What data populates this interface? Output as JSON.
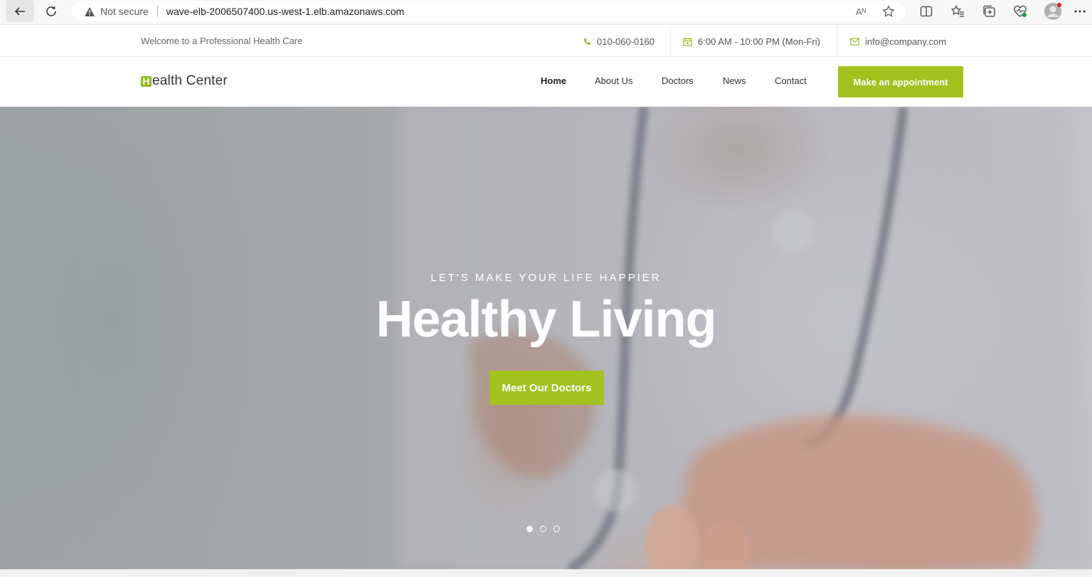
{
  "browser": {
    "security_label": "Not secure",
    "url": "wave-elb-2006507400.us-west-1.elb.amazonaws.com",
    "read_aloud_label": "Aᴺ"
  },
  "topbar": {
    "welcome": "Welcome to a Professional Health Care",
    "phone": "010-060-0160",
    "hours": "6:00 AM - 10:00 PM (Mon-Fri)",
    "email": "info@company.com"
  },
  "nav": {
    "logo_initial": "H",
    "logo_rest": "ealth Center",
    "items": [
      {
        "label": "Home"
      },
      {
        "label": "About Us"
      },
      {
        "label": "Doctors"
      },
      {
        "label": "News"
      },
      {
        "label": "Contact"
      }
    ],
    "cta": "Make an appointment"
  },
  "hero": {
    "subtitle": "LET'S MAKE YOUR LIFE HAPPIER",
    "title": "Healthy Living",
    "button": "Meet Our Doctors",
    "slides": 3,
    "active_slide": 1
  },
  "colors": {
    "accent": "#a3c11f",
    "text": "#333333",
    "muted": "#666666"
  }
}
